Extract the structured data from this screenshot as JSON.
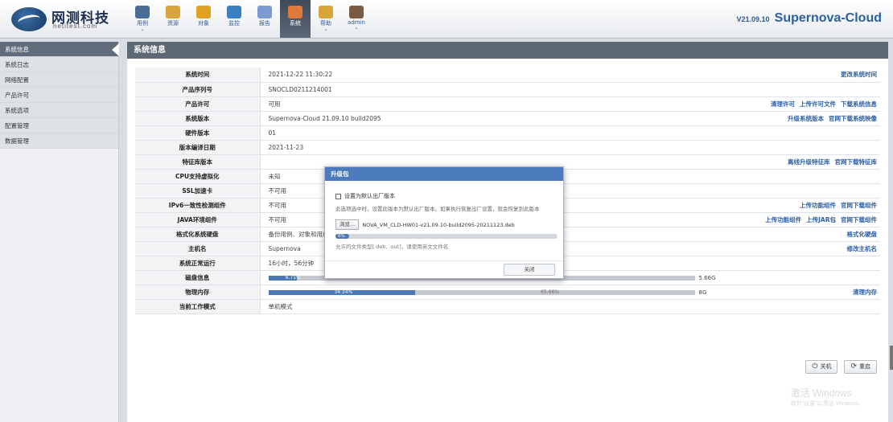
{
  "logo": {
    "cn": "网测科技",
    "en": "netitest.com"
  },
  "nav": [
    {
      "label": "用例",
      "icon": "monitor-icon",
      "dropdown": true
    },
    {
      "label": "资源",
      "icon": "disc-icon",
      "dropdown": false
    },
    {
      "label": "对象",
      "icon": "folder-icon",
      "dropdown": false
    },
    {
      "label": "监控",
      "icon": "gauge-icon",
      "dropdown": false
    },
    {
      "label": "报告",
      "icon": "pen-report-icon",
      "dropdown": false
    },
    {
      "label": "系统",
      "icon": "system-icon",
      "dropdown": false,
      "active": true
    },
    {
      "label": "帮助",
      "icon": "help-book-icon",
      "dropdown": true
    },
    {
      "label": "admin",
      "icon": "user-icon",
      "dropdown": true
    }
  ],
  "version": {
    "number": "V21.09.10",
    "product": "Supernova-Cloud"
  },
  "sidebar": [
    {
      "label": "系统信息",
      "active": true
    },
    {
      "label": "系统日志"
    },
    {
      "label": "网络配置"
    },
    {
      "label": "产品许可"
    },
    {
      "label": "系统选项"
    },
    {
      "label": "配置管理"
    },
    {
      "label": "数据管理"
    }
  ],
  "main": {
    "title": "系统信息",
    "rows": [
      {
        "key": "系统时间",
        "value": "2021-12-22 11:30:22",
        "actions": [
          "更改系统时间"
        ]
      },
      {
        "key": "产品序列号",
        "value": "SNOCLD0211214001",
        "actions": []
      },
      {
        "key": "产品许可",
        "value": "可用",
        "actions": [
          "清理许可",
          "上传许可文件",
          "下载系统信息"
        ]
      },
      {
        "key": "系统版本",
        "value": "Supernova-Cloud 21.09.10 build2095",
        "actions": [
          "升级系统版本",
          "官网下载系统映像"
        ]
      },
      {
        "key": "硬件版本",
        "value": "01",
        "actions": []
      },
      {
        "key": "版本编译日期",
        "value": "2021-11-23",
        "actions": []
      },
      {
        "key": "特征库版本",
        "value": "",
        "actions": [
          "离线升级特征库",
          "官网下载特征库"
        ]
      },
      {
        "key": "CPU支持虚拟化",
        "value": "未知",
        "actions": []
      },
      {
        "key": "SSL加速卡",
        "value": "不可用",
        "actions": []
      },
      {
        "key": "IPv6一致性检测组件",
        "value": "不可用",
        "actions": [
          "上传功能组件",
          "官网下载组件"
        ]
      },
      {
        "key": "JAVA环境组件",
        "value": "不可用",
        "actions": [
          "上传功能组件",
          "上传JAR包",
          "官网下载组件"
        ]
      },
      {
        "key": "格式化系统硬盘",
        "value": "备份用例、对象和用户",
        "actions": [
          "格式化硬盘"
        ]
      },
      {
        "key": "主机名",
        "value": "Supernova",
        "actions": [
          "修改主机名"
        ]
      },
      {
        "key": "系统正常运行",
        "value": "16小时，56分钟",
        "actions": []
      },
      {
        "key": "磁盘信息",
        "value": "",
        "bar": {
          "used_pct": 6.71,
          "used": "6.71%",
          "free": "93.29%",
          "size": "5.66G"
        },
        "actions": []
      },
      {
        "key": "物理内存",
        "value": "",
        "bar": {
          "used_pct": 34.34,
          "used": "34.34%",
          "free": "65.66%",
          "size": "8G"
        },
        "actions": [
          "清理内存"
        ]
      },
      {
        "key": "当前工作模式",
        "value": "单机模式",
        "actions": []
      }
    ],
    "buttons": {
      "shutdown": "关机",
      "restart": "重启"
    },
    "watermark": {
      "line1": "激活 Windows",
      "line2": "转到\"设置\"以激活 Windows。"
    }
  },
  "modal": {
    "title": "升级包",
    "checkbox_label": "设置为默认出厂版本",
    "note": "此选项选中时，设置此版本为默认出厂版本。如果执行恢复出厂设置，就会恢复到此版本",
    "browse": "浏览...",
    "filename": "NOVA_VM_CLD-HW01-v21.09.10-build2095-20211123.deb",
    "progress_pct": 6,
    "progress_label": "6%",
    "allowed": "允许的文件类型[.deb, .out]，请使用英文文件名",
    "close": "关闭"
  }
}
